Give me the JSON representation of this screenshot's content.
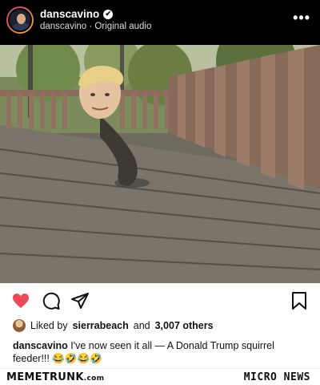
{
  "header": {
    "username": "danscavino",
    "verified_mark": "✔",
    "subline": "danscavino · Original audio",
    "more_label": "•••"
  },
  "media": {
    "subject": "squirrel-feeder-head-icon"
  },
  "actions": {
    "like_icon": "heart-icon",
    "like_color": "#ed4956",
    "comment_icon": "comment-icon",
    "share_icon": "share-icon",
    "save_icon": "bookmark-icon"
  },
  "likes": {
    "prefix": "Liked by",
    "user": "sierrabeach",
    "connector": "and",
    "count": "3,007 others"
  },
  "caption": {
    "user": "danscavino",
    "text": "I've now seen it all — A Donald Trump squirrel feeder!!! 😂🤣😂🤣"
  },
  "footer": {
    "brand": "MEMETRUNK",
    "brand_suffix": ".com",
    "micro": "MICRO NEWS"
  }
}
